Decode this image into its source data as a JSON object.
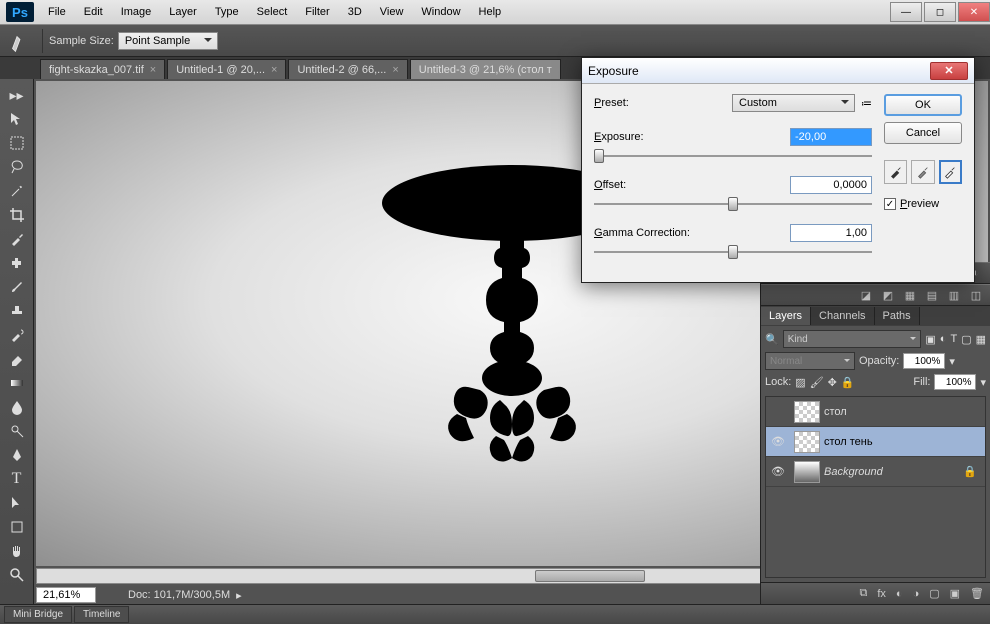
{
  "menubar": [
    "File",
    "Edit",
    "Image",
    "Layer",
    "Type",
    "Select",
    "Filter",
    "3D",
    "View",
    "Window",
    "Help"
  ],
  "options": {
    "sample_label": "Sample Size:",
    "sample_value": "Point Sample"
  },
  "tabs": [
    {
      "label": "fight-skazka_007.tif",
      "active": false
    },
    {
      "label": "Untitled-1 @ 20,...",
      "active": false
    },
    {
      "label": "Untitled-2 @ 66,...",
      "active": false
    },
    {
      "label": "Untitled-3 @ 21,6% (стол т",
      "active": true
    }
  ],
  "status": {
    "zoom": "21,61%",
    "doc": "Doc: 101,7M/300,5M"
  },
  "bottom_tabs": [
    "Mini Bridge",
    "Timeline"
  ],
  "layers_panel": {
    "tabs": [
      "Layers",
      "Channels",
      "Paths"
    ],
    "kind": "Kind",
    "blend": "Normal",
    "opacity_label": "Opacity:",
    "opacity": "100%",
    "lock_label": "Lock:",
    "fill_label": "Fill:",
    "fill": "100%",
    "items": [
      {
        "name": "стол",
        "visible": false,
        "locked": false
      },
      {
        "name": "стол тень",
        "visible": true,
        "locked": false,
        "selected": true
      },
      {
        "name": "Background",
        "visible": true,
        "locked": true,
        "italic": true
      }
    ]
  },
  "dialog": {
    "title": "Exposure",
    "preset_label": "Preset:",
    "preset_value": "Custom",
    "ok": "OK",
    "cancel": "Cancel",
    "exposure_label": "Exposure:",
    "exposure_value": "-20,00",
    "offset_label": "Offset:",
    "offset_value": "0,0000",
    "gamma_label": "Gamma Correction:",
    "gamma_value": "1,00",
    "preview_label": "Preview"
  }
}
